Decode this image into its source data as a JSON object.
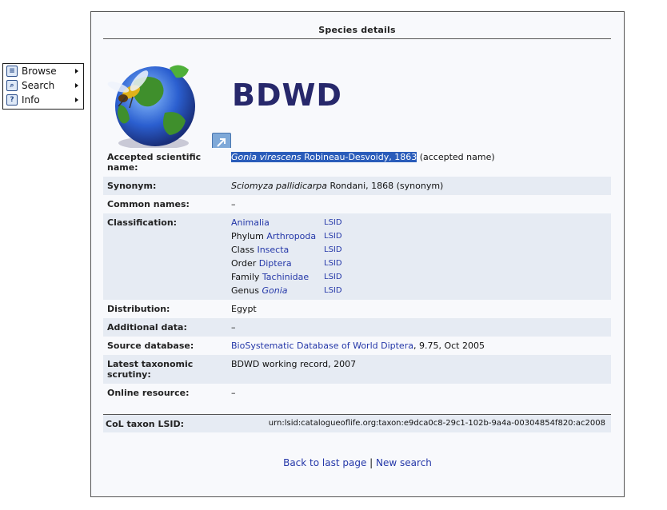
{
  "menu": {
    "items": [
      {
        "label": "Browse",
        "icon": "book-icon"
      },
      {
        "label": "Search",
        "icon": "search-icon"
      },
      {
        "label": "Info",
        "icon": "question-icon"
      }
    ]
  },
  "panel": {
    "title": "Species details",
    "db_logo_name": "BDWD"
  },
  "details": {
    "accepted": {
      "label": "Accepted scientific name:",
      "genus_species": "Gonia virescens",
      "author": "Robineau-Desvoidy, 1863",
      "status": "(accepted name)"
    },
    "synonym": {
      "label": "Synonym:",
      "name": "Sciomyza pallidicarpa",
      "rest": "Rondani, 1868 (synonym)"
    },
    "common_names": {
      "label": "Common names:",
      "value": "–"
    },
    "classification": {
      "label": "Classification:",
      "lsid_label": "LSID",
      "ranks": [
        {
          "rank": "",
          "name": "Animalia",
          "italic": false
        },
        {
          "rank": "Phylum",
          "name": "Arthropoda",
          "italic": false
        },
        {
          "rank": "Class",
          "name": "Insecta",
          "italic": false
        },
        {
          "rank": "Order",
          "name": "Diptera",
          "italic": false
        },
        {
          "rank": "Family",
          "name": "Tachinidae",
          "italic": false
        },
        {
          "rank": "Genus",
          "name": "Gonia",
          "italic": true
        }
      ]
    },
    "distribution": {
      "label": "Distribution:",
      "value": "Egypt"
    },
    "additional": {
      "label": "Additional data:",
      "value": "–"
    },
    "source": {
      "label": "Source database:",
      "link": "BioSystematic Database of World Diptera",
      "rest": ", 9.75, Oct 2005"
    },
    "scrutiny": {
      "label": "Latest taxonomic scrutiny:",
      "value": "BDWD working record, 2007"
    },
    "online": {
      "label": "Online resource:",
      "value": "–"
    },
    "col_lsid": {
      "label": "CoL taxon LSID:",
      "value": "urn:lsid:catalogueoflife.org:taxon:e9dca0c8-29c1-102b-9a4a-00304854f820:ac2008"
    }
  },
  "footer": {
    "back_label": "Back to last page",
    "separator": "|",
    "new_search_label": "New search"
  },
  "colors": {
    "link": "#2437a8",
    "logo_text": "#27286b",
    "row_alt": "#e6ebf3",
    "highlight": "#2a5cba"
  }
}
